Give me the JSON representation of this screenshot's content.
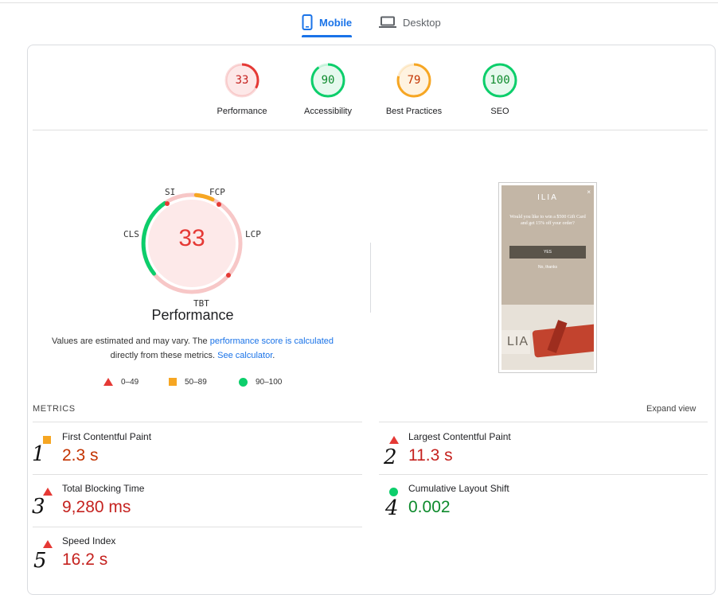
{
  "tabs": {
    "mobile": "Mobile",
    "desktop": "Desktop"
  },
  "categories": [
    {
      "score": "33",
      "label": "Performance",
      "color": "#e53935",
      "bg": "#fde8e8",
      "fraction": 0.33
    },
    {
      "score": "90",
      "label": "Accessibility",
      "color": "#0cce6b",
      "bg": "#e6f9ee",
      "fraction": 0.9
    },
    {
      "score": "79",
      "label": "Best Practices",
      "color": "#f6a623",
      "bg": "#fff3e0",
      "fraction": 0.79
    },
    {
      "score": "100",
      "label": "SEO",
      "color": "#0cce6b",
      "bg": "#e6f9ee",
      "fraction": 1.0
    }
  ],
  "performance": {
    "score": "33",
    "title": "Performance",
    "tags": {
      "si": "SI",
      "fcp": "FCP",
      "lcp": "LCP",
      "tbt": "TBT",
      "cls": "CLS"
    },
    "note_prefix": "Values are estimated and may vary. The ",
    "note_link1": "performance score is calculated",
    "note_middle": " directly from these metrics. ",
    "note_link2": "See calculator",
    "note_suffix": "."
  },
  "legend": {
    "poor": "0–49",
    "average": "50–89",
    "good": "90–100"
  },
  "screenshot": {
    "brand": "ILIA",
    "close": "×",
    "question": "Would you like to win a $500 Gift Card and get 15% off your order?",
    "yes": "YES",
    "no": "No, thanks",
    "product_text": "LIA"
  },
  "metrics_section": {
    "heading": "METRICS",
    "expand": "Expand view"
  },
  "metrics": [
    {
      "name": "First Contentful Paint",
      "value": "2.3 s",
      "rating": "average",
      "annotation": "1"
    },
    {
      "name": "Largest Contentful Paint",
      "value": "11.3 s",
      "rating": "poor",
      "annotation": "2"
    },
    {
      "name": "Total Blocking Time",
      "value": "9,280 ms",
      "rating": "poor",
      "annotation": "3"
    },
    {
      "name": "Cumulative Layout Shift",
      "value": "0.002",
      "rating": "good",
      "annotation": "4"
    },
    {
      "name": "Speed Index",
      "value": "16.2 s",
      "rating": "poor",
      "annotation": "5"
    }
  ],
  "colors": {
    "poor": "#e53935",
    "average": "#f6a623",
    "good": "#0cce6b",
    "accent": "#1a73e8"
  }
}
